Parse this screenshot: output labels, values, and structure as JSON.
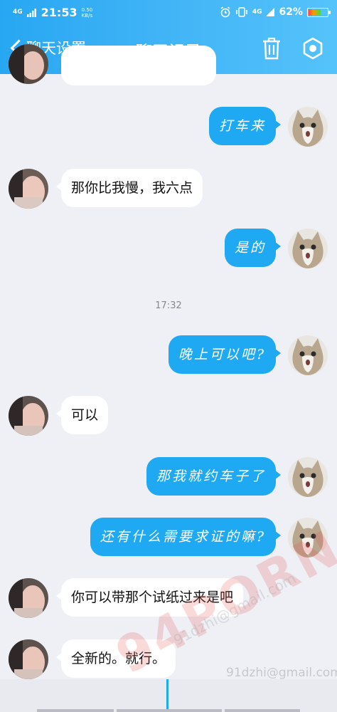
{
  "status_bar": {
    "network": "4G",
    "time": "21:53",
    "speed_value": "0.50",
    "speed_unit": "KB/s",
    "signal_right": "4G",
    "battery_percent": "62%"
  },
  "nav": {
    "back_label": "聊天设置",
    "title": "聊天记录"
  },
  "messages": [
    {
      "side": "right",
      "text": "打车来"
    },
    {
      "side": "left",
      "text": "那你比我慢，我六点"
    },
    {
      "side": "right",
      "text": "是的"
    },
    {
      "side": "time",
      "text": "17:32"
    },
    {
      "side": "right",
      "text": "晚上可以吧?"
    },
    {
      "side": "left",
      "text": "可以"
    },
    {
      "side": "right",
      "text": "那我就约车子了"
    },
    {
      "side": "right",
      "text": "还有什么需要求证的嘛?"
    },
    {
      "side": "left",
      "text": "你可以带那个试纸过来是吧"
    },
    {
      "side": "left",
      "text": "全新的。就行。"
    }
  ],
  "watermark": {
    "text": "94PORN",
    "email": "91dzhi@gmail.com"
  },
  "colors": {
    "header_start": "#27a7f2",
    "header_end": "#55c3fb",
    "bubble_sent": "#1ea9f2",
    "bubble_received": "#ffffff",
    "background": "#eef0f6"
  }
}
